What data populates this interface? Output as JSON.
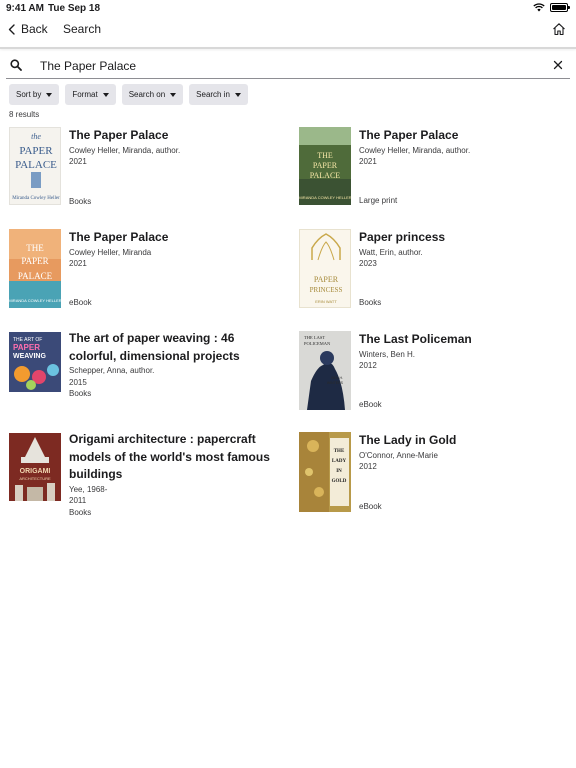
{
  "status": {
    "time": "9:41 AM",
    "date": "Tue Sep 18"
  },
  "nav": {
    "back_label": "Back",
    "title": "Search"
  },
  "search": {
    "value": "The Paper Palace"
  },
  "filters": [
    "Sort by",
    "Format",
    "Search on",
    "Search in"
  ],
  "results_count": "8 results",
  "results": [
    {
      "title": "The Paper Palace",
      "author": "Cowley Heller, Miranda, author.",
      "year": "2021",
      "format": "Books",
      "cover": {
        "top_text": "the",
        "big_text": "PAPER PALACE",
        "bottom_text": "Miranda Cowley Heller",
        "bg": "#f5f3ee",
        "fg": "#3a5c8c"
      }
    },
    {
      "title": "The Paper Palace",
      "author": "Cowley Heller, Miranda, author.",
      "year": "2021",
      "format": "Large print",
      "cover": {
        "big_text": "THE PAPER PALACE",
        "bottom_text": "MIRANDA COWLEY HELLER",
        "bg": "#4f6b3a",
        "fg": "#f7e7a8"
      }
    },
    {
      "title": "The Paper Palace",
      "author": "Cowley Heller, Miranda",
      "year": "2021",
      "format": "eBook",
      "cover": {
        "big_text": "THE PAPER PALACE",
        "bottom_text": "MIRANDA COWLEY HELLER",
        "bg": "#e79a5f",
        "fg": "#ffffff"
      }
    },
    {
      "title": "Paper princess",
      "author": "Watt, Erin, author.",
      "year": "2023",
      "format": "Books",
      "cover": {
        "big_text": "PAPER PRINCESS",
        "bottom_text": "ERIN WATT",
        "bg": "#faf6ec",
        "fg": "#a68a3a"
      }
    },
    {
      "title": "The art of paper weaving : 46 colorful, dimensional projects",
      "author": "Schepper, Anna, author.",
      "year": "2015",
      "format": "Books",
      "cover": {
        "top_text": "THE ART OF",
        "big_text": "PAPER WEAVING",
        "bg": "#3b4a78",
        "fg": "#ffffff"
      }
    },
    {
      "title": "The Last Policeman",
      "author": "Winters, Ben H.",
      "year": "2012",
      "format": "eBook",
      "cover": {
        "top_text": "THE LAST POLICEMAN",
        "bottom_text": "BEN H. WINTERS",
        "bg": "#d9d9d6",
        "fg": "#2a2a2a"
      }
    },
    {
      "title": "Origami architecture : papercraft models of the world's most famous buildings",
      "author": "Yee, 1968-",
      "year": "2011",
      "format": "Books",
      "cover": {
        "big_text": "ORIGAMI ARCHITECTURE",
        "bg": "#7d2a22",
        "fg": "#f1d7b0"
      }
    },
    {
      "title": "The Lady in Gold",
      "author": "O'Connor, Anne-Marie",
      "year": "2012",
      "format": "eBook",
      "cover": {
        "big_text": "THE LADY IN GOLD",
        "bottom_text": "ANNE-MARIE O'CONNOR",
        "bg": "#b89a4a",
        "fg": "#1c1c1c"
      }
    }
  ]
}
